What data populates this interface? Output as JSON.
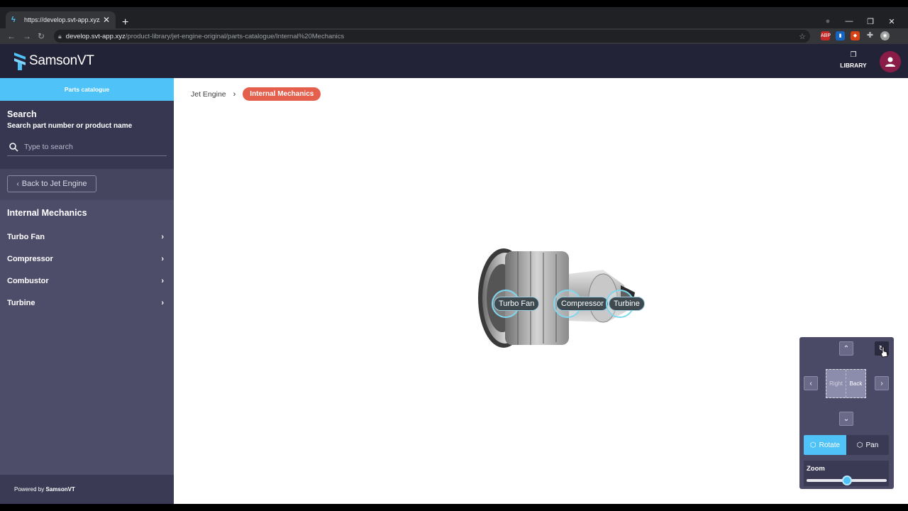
{
  "browser": {
    "tab_title": "https://develop.svt-app.xyz/prod",
    "url_host": "develop.svt-app.xyz",
    "url_path": "/product-library/jet-engine-original/parts-catalogue/Internal%20Mechanics",
    "new_tab_glyph": "+",
    "tab_close_glyph": "✕"
  },
  "header": {
    "logo_text": "SamsonVT",
    "library_label": "LIBRARY"
  },
  "sidebar": {
    "tab_label": "Parts catalogue",
    "search": {
      "title": "Search",
      "subtitle": "Search part number or product name",
      "placeholder": "Type to search"
    },
    "back_label": "Back to Jet Engine",
    "section_title": "Internal Mechanics",
    "items": [
      {
        "label": "Turbo Fan"
      },
      {
        "label": "Compressor"
      },
      {
        "label": "Combustor"
      },
      {
        "label": "Turbine"
      }
    ],
    "footer_prefix": "Powered by ",
    "footer_brand": "SamsonVT"
  },
  "main": {
    "breadcrumb": {
      "parent": "Jet Engine",
      "current": "Internal Mechanics"
    },
    "hotspots": [
      {
        "label": "Turbo Fan"
      },
      {
        "label": "Compressor"
      },
      {
        "label": "Turbine"
      }
    ]
  },
  "controls": {
    "cube_left_face": "Right",
    "cube_right_face": "Back",
    "rotate_label": "Rotate",
    "pan_label": "Pan",
    "zoom_label": "Zoom",
    "zoom_level": 0.5,
    "active_mode": "Rotate"
  },
  "colors": {
    "accent": "#4fc3f7",
    "header_bg": "#232337",
    "sidebar_bg": "#4d4d6a",
    "breadcrumb_current": "#e4604c",
    "avatar": "#8a1c48"
  }
}
